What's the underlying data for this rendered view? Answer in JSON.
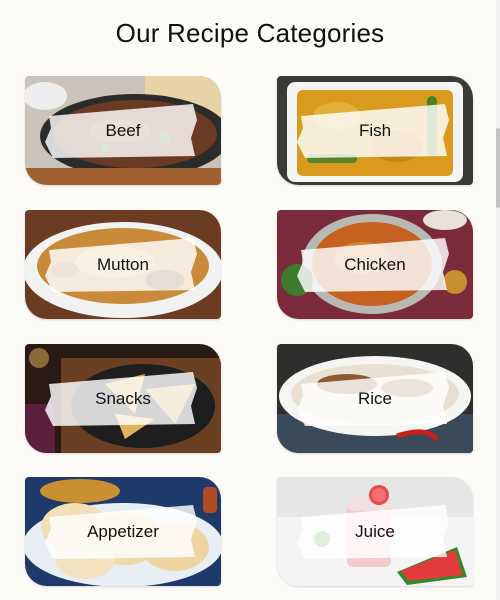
{
  "page": {
    "title": "Our Recipe Categories"
  },
  "categories": [
    {
      "label": "Beef"
    },
    {
      "label": "Fish"
    },
    {
      "label": "Mutton"
    },
    {
      "label": "Chicken"
    },
    {
      "label": "Snacks"
    },
    {
      "label": "Rice"
    },
    {
      "label": "Appetizer"
    },
    {
      "label": "Juice"
    }
  ]
}
